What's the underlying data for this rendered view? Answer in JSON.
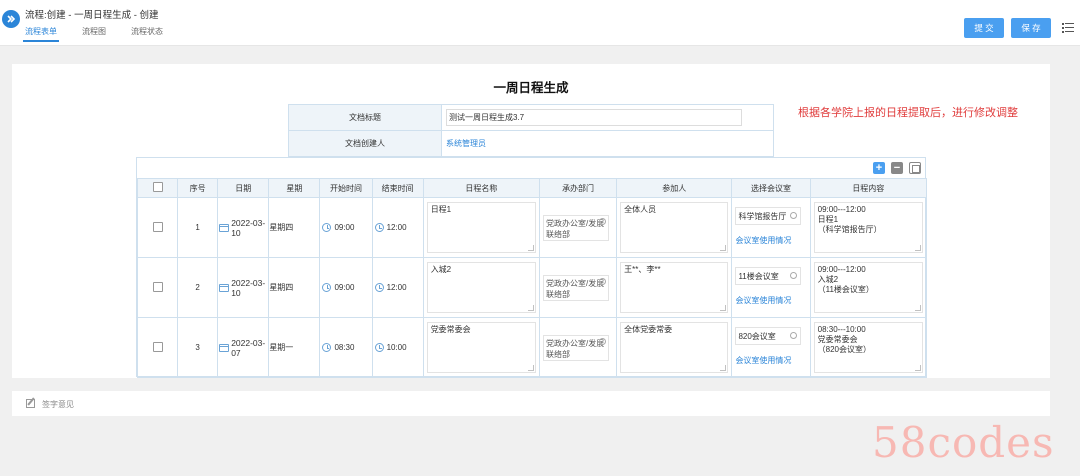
{
  "header": {
    "breadcrumb": "流程:创建 - 一周日程生成 - 创建",
    "tabs": [
      {
        "label": "流程表单",
        "active": true
      },
      {
        "label": "流程图",
        "active": false
      },
      {
        "label": "流程状态",
        "active": false
      }
    ],
    "submit_label": "提 交",
    "save_label": "保 存"
  },
  "form": {
    "title": "一周日程生成",
    "note": "根据各学院上报的日程提取后，进行修改调整",
    "doc_title_label": "文档标题",
    "doc_title_value": "测试一周日程生成3.7",
    "creator_label": "文档创建人",
    "creator_value": "系统管理员"
  },
  "table": {
    "columns": [
      "序号",
      "日期",
      "星期",
      "开始时间",
      "结束时间",
      "日程名称",
      "承办部门",
      "参加人",
      "选择会议室",
      "日程内容"
    ],
    "rows": [
      {
        "no": "1",
        "date": "2022-03-10",
        "weekday": "星期四",
        "start": "09:00",
        "end": "12:00",
        "name": "日程1",
        "dept": "党政办公室/发展联络部",
        "participants": "全体人员",
        "room": "科学馆报告厅",
        "room_link": "会议室使用情况",
        "content": "09:00---12:00\n日程1\n（科学馆报告厅）"
      },
      {
        "no": "2",
        "date": "2022-03-10",
        "weekday": "星期四",
        "start": "09:00",
        "end": "12:00",
        "name": "入城2",
        "dept": "党政办公室/发展联络部",
        "participants": "王**、李**",
        "room": "11楼会议室",
        "room_link": "会议室使用情况",
        "content": "09:00---12:00\n入城2\n（11楼会议室）"
      },
      {
        "no": "3",
        "date": "2022-03-07",
        "weekday": "星期一",
        "start": "08:30",
        "end": "10:00",
        "name": "党委常委会",
        "dept": "党政办公室/发展联络部",
        "participants": "全体党委常委",
        "room": "820会议室",
        "room_link": "会议室使用情况",
        "content": "08:30---10:00\n党委常委会\n（820会议室）"
      }
    ]
  },
  "sign": {
    "label": "签字意见"
  },
  "watermark": "58codes",
  "colors": {
    "accent": "#2b85d8",
    "note": "#e03c3c",
    "button": "#4a9ff0"
  },
  "icons": [
    "app-logo-icon",
    "menu-icon",
    "add-row-icon",
    "remove-row-icon",
    "copy-row-icon",
    "calendar-icon",
    "clock-icon",
    "search-icon",
    "signature-icon"
  ]
}
